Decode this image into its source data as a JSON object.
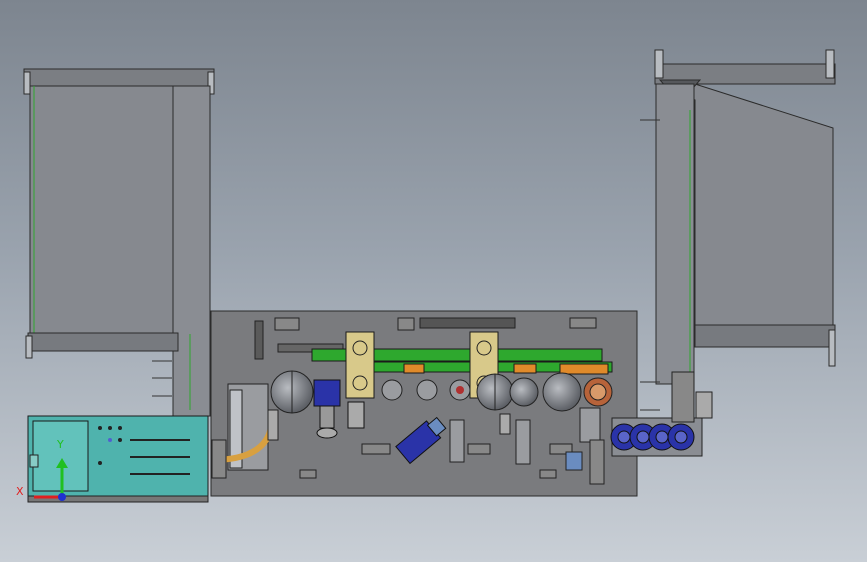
{
  "viewport": {
    "background_top": "#7d858f",
    "background_bottom": "#c9cfd6"
  },
  "triad": {
    "x_label": "X",
    "y_label": "Y",
    "x_color": "#e02020",
    "y_color": "#20c020",
    "z_color": "#2030d0"
  },
  "colors": {
    "frame_gray": "#6e7176",
    "panel_gray": "#86898f",
    "plate_gray": "#7a7b7e",
    "edge": "#2b2b2b",
    "green": "#2ea82e",
    "orange": "#e08a2a",
    "yellow_panel": "#d8c98a",
    "teal": "#4fb3ad",
    "blue": "#2a33a8",
    "light_blue": "#6a8cc0"
  },
  "parts": [
    "left-feeder-frame",
    "right-feeder-frame",
    "main-base-plate",
    "control-panel",
    "conveyor-belt",
    "roller-1",
    "roller-2",
    "roller-3",
    "roller-4",
    "spindle-blue-motor",
    "inclined-motor",
    "blue-roller-unit",
    "cam-plate-1",
    "cam-plate-2"
  ]
}
